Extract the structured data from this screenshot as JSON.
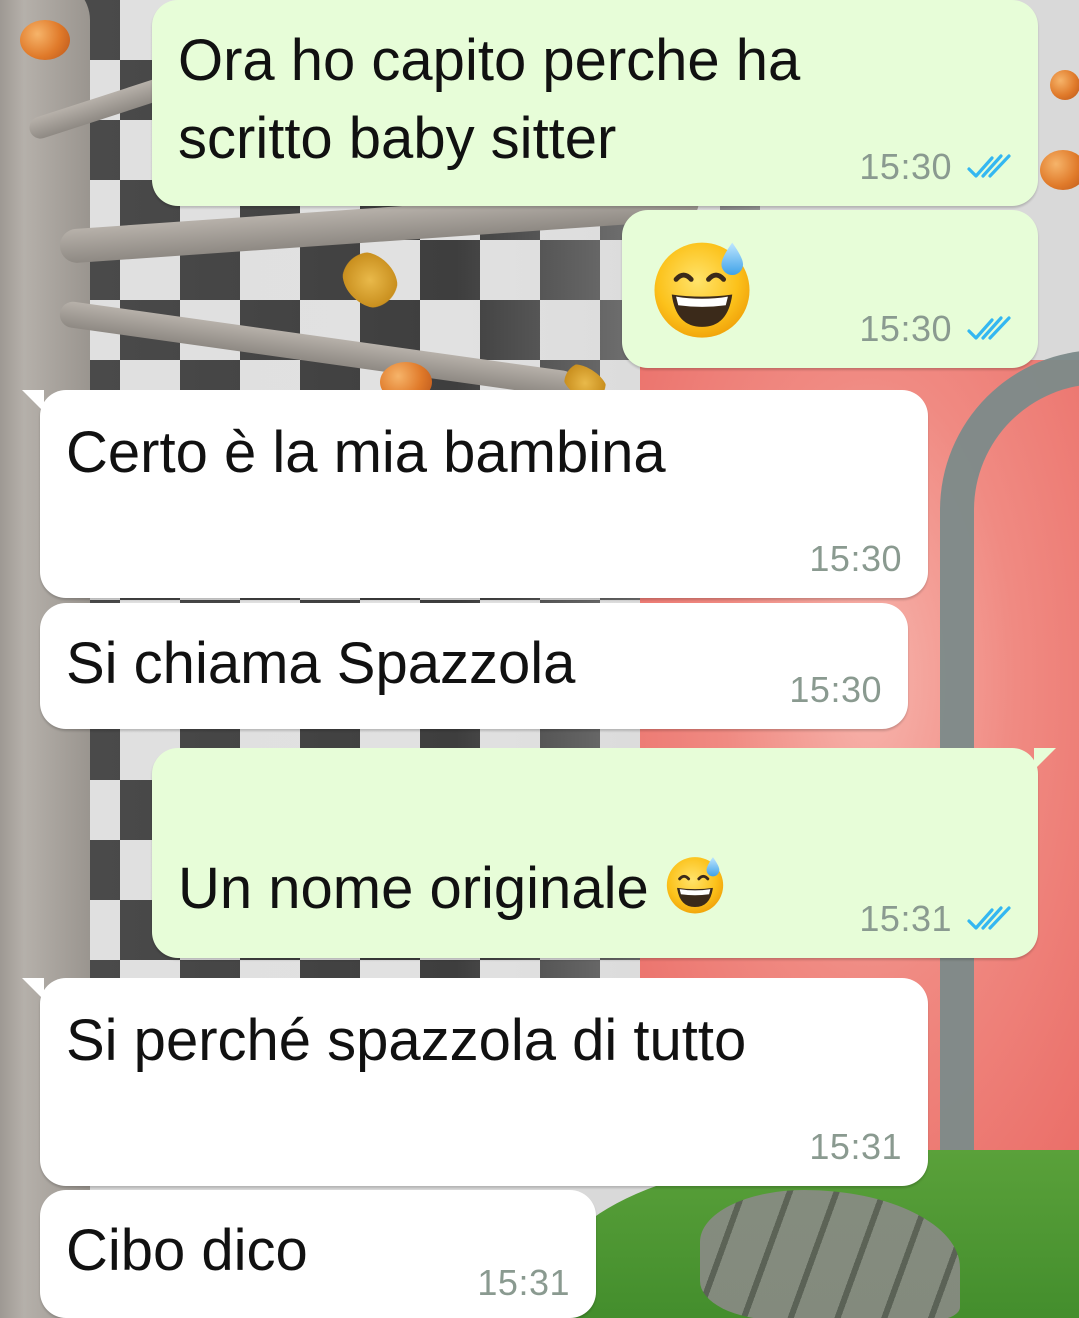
{
  "theme": {
    "outgoing_bubble": "#e7fdd8",
    "incoming_bubble": "#ffffff",
    "time_color": "#8a9a90",
    "read_tick_color": "#34b7f1"
  },
  "messages": [
    {
      "direction": "outgoing",
      "text": "Ora ho capito perche ha\nscritto baby sitter",
      "time": "15:30",
      "status": "read-double-tick-icon"
    },
    {
      "direction": "outgoing",
      "emoji": "grinning-face-with-sweat-icon",
      "time": "15:30",
      "status": "read-double-tick-icon"
    },
    {
      "direction": "incoming",
      "text": "Certo è la mia bambina",
      "time": "15:30"
    },
    {
      "direction": "incoming",
      "text": "Si chiama Spazzola",
      "time": "15:30"
    },
    {
      "direction": "outgoing",
      "text": "Un nome originale",
      "emoji": "grinning-face-with-sweat-icon",
      "time": "15:31",
      "status": "read-double-tick-icon"
    },
    {
      "direction": "incoming",
      "text": "Si perché spazzola di tutto",
      "time": "15:31"
    },
    {
      "direction": "incoming",
      "text": "Cibo dico",
      "time": "15:31"
    }
  ]
}
